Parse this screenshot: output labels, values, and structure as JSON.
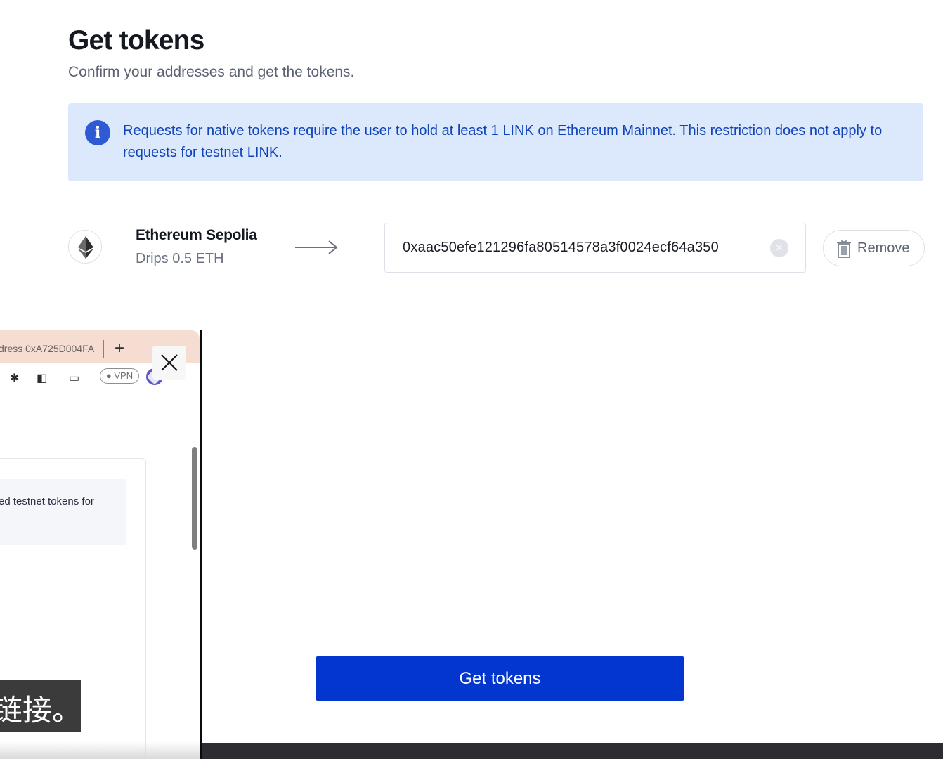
{
  "page": {
    "title": "Get tokens",
    "subtitle": "Confirm your addresses and get the tokens."
  },
  "info_banner": {
    "icon": "info-icon",
    "text": "Requests for native tokens require the user to hold at least 1 LINK on Ethereum Mainnet. This restriction does not apply to requests for testnet LINK."
  },
  "network": {
    "icon": "ethereum-icon",
    "name": "Ethereum Sepolia",
    "drip": "Drips 0.5 ETH",
    "address": "0xaac50efe121296fa80514578a3f0024ecf64a350",
    "clear_icon": "×",
    "remove_label": "Remove"
  },
  "submit": {
    "label": "Get tokens"
  },
  "overlay": {
    "tab_text": "dress 0xA725D004FA",
    "new_tab": "+",
    "vpn_label": "● VPN",
    "notice_text": "ed testnet tokens for",
    "subtitle_text": "链接。",
    "menu": "☰"
  },
  "colors": {
    "accent": "#0336cf",
    "info_bg": "#dce9fd",
    "info_text": "#1043b8"
  }
}
